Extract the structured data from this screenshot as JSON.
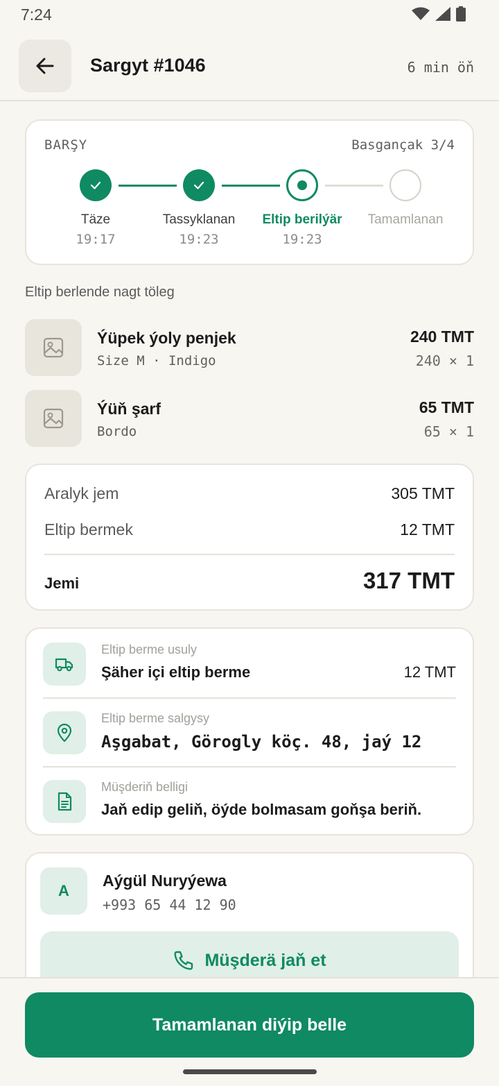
{
  "status_bar": {
    "time": "7:24",
    "icons": [
      "wifi-icon",
      "signal-icon",
      "battery-icon"
    ]
  },
  "header": {
    "title": "Sargyt #1046",
    "ago": "6 min öň"
  },
  "progress": {
    "label": "BARŞY",
    "step_count": "Basgançak 3/4",
    "steps": [
      {
        "name": "Täze",
        "time": "19:17",
        "state": "done"
      },
      {
        "name": "Tassyklanan",
        "time": "19:23",
        "state": "done"
      },
      {
        "name": "Eltip berilýär",
        "time": "19:23",
        "state": "current"
      },
      {
        "name": "Tamamlanan",
        "time": "",
        "state": "todo"
      }
    ]
  },
  "payment_note": "Eltip berlende nagt töleg",
  "items": [
    {
      "name": "Ýüpek ýoly penjek",
      "variant": "Size M · Indigo",
      "price": "240 TMT",
      "qty": "240 × 1"
    },
    {
      "name": "Ýüň şarf",
      "variant": "Bordo",
      "price": "65 TMT",
      "qty": "65 × 1"
    }
  ],
  "totals": {
    "subtotal_label": "Aralyk jem",
    "subtotal": "305 TMT",
    "delivery_label": "Eltip bermek",
    "delivery": "12 TMT",
    "total_label": "Jemi",
    "total": "317 TMT"
  },
  "delivery": {
    "method_caption": "Eltip berme usuly",
    "method": "Şäher içi eltip berme",
    "method_price": "12 TMT",
    "address_caption": "Eltip berme salgysy",
    "address": "Aşgabat, Görogly köç. 48, jaý 12",
    "note_caption": "Müşderiň belligi",
    "note": "Jaň edip geliň, öýde bolmasam goňşa beriň."
  },
  "customer": {
    "initial": "A",
    "name": "Aýgül Nuryýewa",
    "phone": "+993 65 44 12 90",
    "call_label": "Müşderä jaň et"
  },
  "primary_action": "Tamamlanan diýip belle",
  "colors": {
    "accent": "#0f8a63",
    "accent_soft": "#e0efe8",
    "background": "#f8f6f1"
  }
}
